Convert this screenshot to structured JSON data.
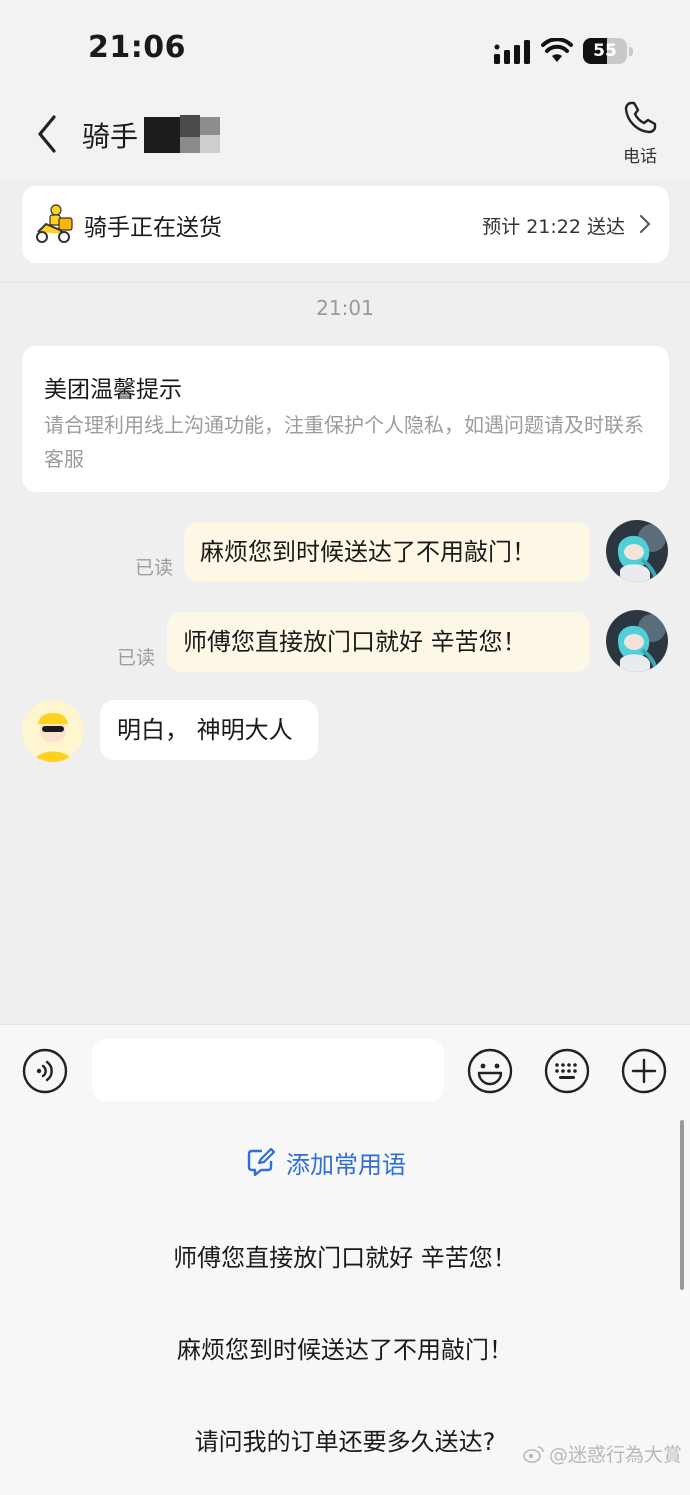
{
  "status_bar": {
    "time": "21:06",
    "battery": "55",
    "battery_level": 0.55
  },
  "header": {
    "title": "骑手",
    "phone_label": "电话"
  },
  "delivery": {
    "status": "骑手正在送货",
    "eta": "预计 21:22 送达"
  },
  "chat": {
    "timestamp": "21:01",
    "notice": {
      "title": "美团温馨提示",
      "body": "请合理利用线上沟通功能，注重保护个人隐私，如遇问题请及时联系客服"
    },
    "messages": [
      {
        "direction": "outgoing",
        "text": "麻烦您到时候送达了不用敲门！",
        "read_label": "已读"
      },
      {
        "direction": "outgoing",
        "text": "师傅您直接放门口就好 辛苦您！",
        "read_label": "已读"
      },
      {
        "direction": "incoming",
        "text": "明白， 神明大人"
      }
    ]
  },
  "input": {
    "placeholder": ""
  },
  "quick_phrases": {
    "add_label": "添加常用语",
    "items": [
      "师傅您直接放门口就好 辛苦您！",
      "麻烦您到时候送达了不用敲门！",
      "请问我的订单还要多久送达?"
    ]
  },
  "watermark": "@迷惑行為大賞",
  "colors": {
    "accent_blue": "#2f6fd6",
    "outgoing_bubble": "#fdf7e6",
    "rider_yellow": "#ffd21f"
  }
}
